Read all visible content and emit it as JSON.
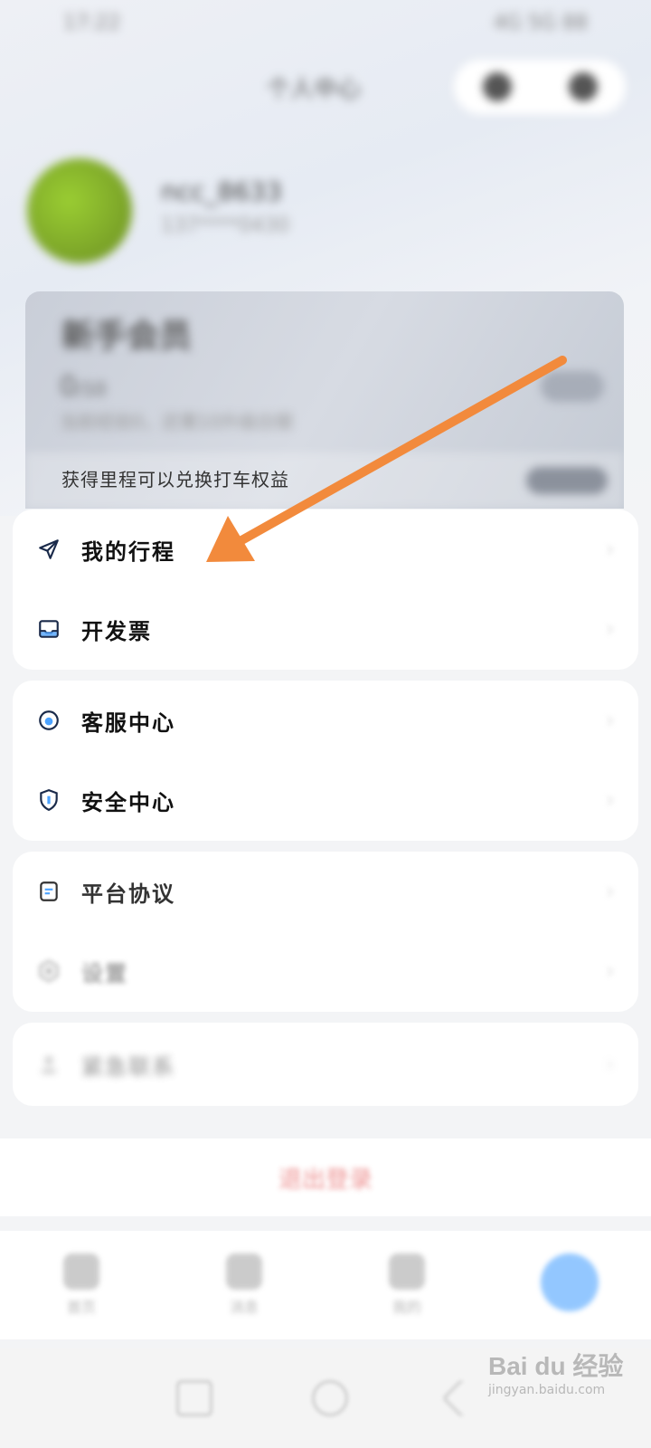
{
  "status_bar": {
    "time": "17:22",
    "indicators": "4G 5G 88"
  },
  "header": {
    "title": "个人中心",
    "icons": [
      "message-icon",
      "settings-icon"
    ]
  },
  "profile": {
    "nickname": "ncc_8633",
    "phone": "137****0430"
  },
  "member_card": {
    "title": "新手会员",
    "progress_value": "0",
    "progress_total": "/10",
    "desc": "当前经验0，还需10升级白银",
    "badge": "",
    "bottom_text": "获得里程可以兑换打车权益"
  },
  "menu_group_1": [
    {
      "label": "我的行程",
      "icon": "send-icon"
    },
    {
      "label": "开发票",
      "icon": "inbox-icon"
    }
  ],
  "menu_group_2": [
    {
      "label": "客服中心",
      "icon": "headset-icon"
    },
    {
      "label": "安全中心",
      "icon": "shield-icon"
    }
  ],
  "menu_group_3": [
    {
      "label": "平台协议",
      "icon": "document-icon"
    },
    {
      "label": "设置",
      "icon": "gear-icon"
    }
  ],
  "menu_group_4": [
    {
      "label": "紧急联系",
      "icon": "person-icon",
      "extra": ""
    }
  ],
  "logout": {
    "label": "退出登录"
  },
  "tabbar": [
    {
      "label": "首页",
      "icon": "home-icon"
    },
    {
      "label": "消息",
      "icon": "message-icon"
    },
    {
      "label": "我的",
      "icon": "user-icon"
    },
    {
      "label": "",
      "icon": "assistant-icon"
    }
  ],
  "watermark": {
    "main": "Bai du 经验",
    "sub": "jingyan.baidu.com"
  },
  "annotation": {
    "arrow_color": "#f28a3c"
  },
  "chevron": "›"
}
